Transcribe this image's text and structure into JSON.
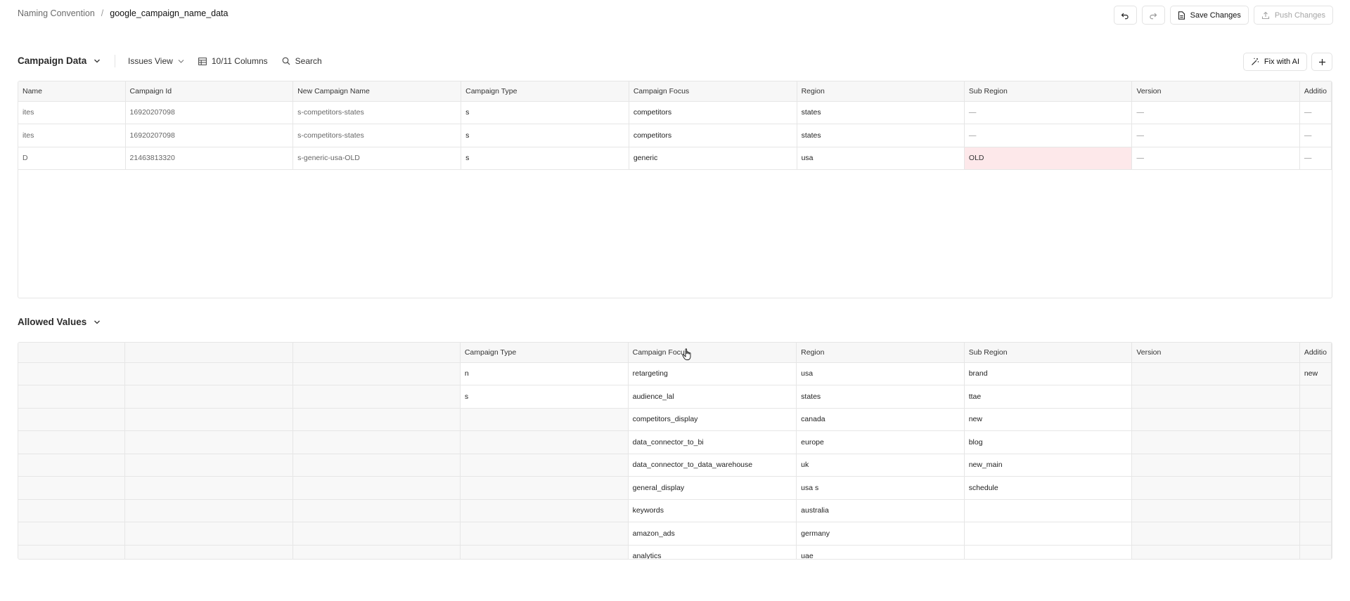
{
  "breadcrumb": {
    "root": "Naming Convention",
    "separator": "/",
    "current": "google_campaign_name_data"
  },
  "actions": {
    "save": "Save Changes",
    "push": "Push Changes"
  },
  "campaign_section": {
    "title": "Campaign Data",
    "view": "Issues View",
    "columns": "10/11 Columns",
    "search": "Search",
    "fix_ai": "Fix with AI",
    "headers": [
      "Name",
      "Campaign Id",
      "New Campaign Name",
      "Campaign Type",
      "Campaign Focus",
      "Region",
      "Sub Region",
      "Version",
      "Additio"
    ],
    "rows": [
      [
        "ites",
        "16920207098",
        "s-competitors-states",
        "s",
        "competitors",
        "states",
        "—",
        "—",
        "—"
      ],
      [
        "ites",
        "16920207098",
        "s-competitors-states",
        "s",
        "competitors",
        "states",
        "—",
        "—",
        "—"
      ],
      [
        "D",
        "21463813320",
        "s-generic-usa-OLD",
        "s",
        "generic",
        "usa",
        "OLD",
        "—",
        "—"
      ]
    ]
  },
  "allowed_section": {
    "title": "Allowed Values",
    "headers": [
      "",
      "",
      "",
      "Campaign Type",
      "Campaign Focus",
      "Region",
      "Sub Region",
      "Version",
      "Additio"
    ],
    "rows": [
      [
        "",
        "",
        "",
        "n",
        "retargeting",
        "usa",
        "brand",
        "",
        "new"
      ],
      [
        "",
        "",
        "",
        "s",
        "audience_lal",
        "states",
        "ttae",
        "",
        ""
      ],
      [
        "",
        "",
        "",
        "",
        "competitors_display",
        "canada",
        "new",
        "",
        ""
      ],
      [
        "",
        "",
        "",
        "",
        "data_connector_to_bi",
        "europe",
        "blog",
        "",
        ""
      ],
      [
        "",
        "",
        "",
        "",
        "data_connector_to_data_warehouse",
        "uk",
        "new_main",
        "",
        ""
      ],
      [
        "",
        "",
        "",
        "",
        "general_display",
        "usa s",
        "schedule",
        "",
        ""
      ],
      [
        "",
        "",
        "",
        "",
        "keywords",
        "australia",
        "",
        "",
        ""
      ],
      [
        "",
        "",
        "",
        "",
        "amazon_ads",
        "germany",
        "",
        "",
        ""
      ],
      [
        "",
        "",
        "",
        "",
        "analytics",
        "uae",
        "",
        "",
        ""
      ]
    ]
  }
}
